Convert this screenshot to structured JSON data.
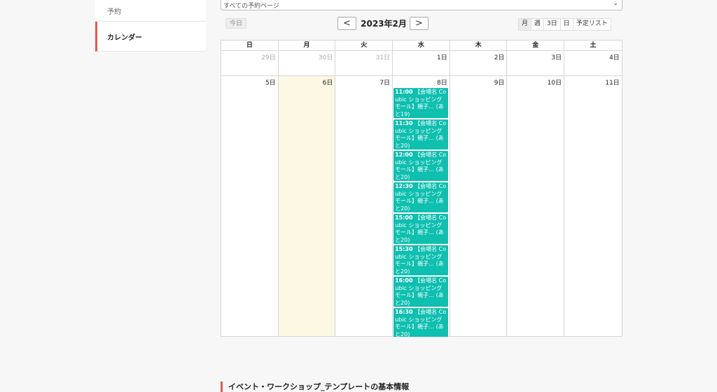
{
  "sidebar": {
    "items": [
      {
        "label": "予約"
      },
      {
        "label": "カレンダー"
      }
    ]
  },
  "filter": {
    "value": "すべての予約ページ"
  },
  "toolbar": {
    "today_label": "今日",
    "prev_label": "<",
    "next_label": ">",
    "title": "2023年2月",
    "views": [
      "月",
      "週",
      "3日",
      "日",
      "予定リスト"
    ]
  },
  "calendar": {
    "weekdays": [
      "日",
      "月",
      "火",
      "水",
      "木",
      "金",
      "土"
    ],
    "week1": [
      "29日",
      "30日",
      "31日",
      "1日",
      "2日",
      "3日",
      "4日"
    ],
    "week2": [
      "5日",
      "6日",
      "7日",
      "8日",
      "9日",
      "10日",
      "11日"
    ],
    "events": [
      {
        "time": "11:00",
        "text": "【会場名 Coubic ショッピングモール】親子… (あと19)"
      },
      {
        "time": "11:30",
        "text": "【会場名 Coubic ショッピングモール】親子… (あと20)"
      },
      {
        "time": "12:00",
        "text": "【会場名 Coubic ショッピングモール】親子… (あと20)"
      },
      {
        "time": "12:30",
        "text": "【会場名 Coubic ショッピングモール】親子… (あと20)"
      },
      {
        "time": "15:00",
        "text": "【会場名 Coubic ショッピングモール】親子… (あと20)"
      },
      {
        "time": "15:30",
        "text": "【会場名 Coubic ショッピングモール】親子… (あと20)"
      },
      {
        "time": "16:00",
        "text": "【会場名 Coubic ショッピングモール】親子… (あと20)"
      },
      {
        "time": "16:30",
        "text": "【会場名 Coubic ショッピングモール】親子… (あと20)"
      }
    ]
  },
  "section": {
    "title": "イベント・ワークショップ_テンプレートの基本情報"
  },
  "colors": {
    "accent": "#e05a4f",
    "event": "#0fbfb0",
    "today": "#fcf8e3"
  }
}
